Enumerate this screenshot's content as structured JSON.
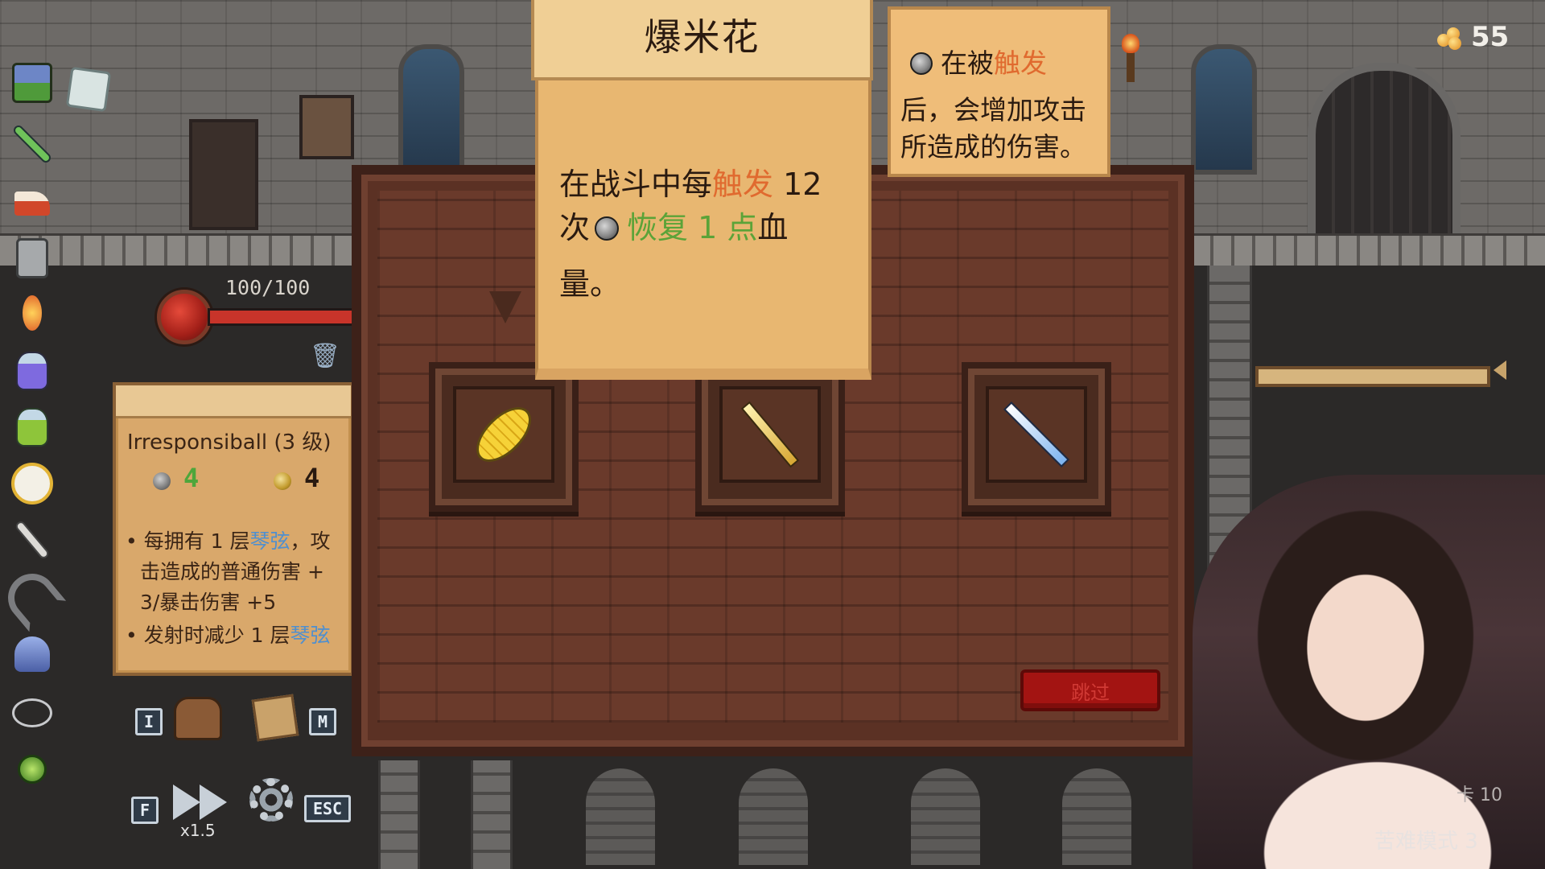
{
  "tooltip": {
    "title": "爆米花",
    "line1_pre": "在战斗中每",
    "line1_trigger": "触发",
    "line1_post": " 12",
    "line2_pre": "次",
    "line2_heal": "恢复 1 点",
    "line2_post": "血",
    "line3": "量。"
  },
  "keyword_card": {
    "line1_pre": "在被",
    "line1_trigger": "触发",
    "line2": "后，会增加攻击",
    "line3": "所造成的伤害。"
  },
  "gold": {
    "count": "55",
    "icon": "gold-nuggets-icon"
  },
  "hp": {
    "text": "100/100",
    "fraction": 1.0
  },
  "item_card": {
    "name": "Irresponsiball (3 级)",
    "stat_gray": "4",
    "stat_gold": "4",
    "bullet1_pre": "每拥有 1 层",
    "bullet1_hl": "琴弦",
    "bullet1_post": "，攻",
    "bullet1_line2": "击造成的普通伤害 +",
    "bullet1_line3": "3/暴击伤害 +5",
    "bullet2_pre": "发射时减少 1 层",
    "bullet2_hl": "琴弦"
  },
  "controls": {
    "i_key": "I",
    "m_key": "M",
    "f_key": "F",
    "speed": "x1.5",
    "esc_key": "ESC"
  },
  "reward": {
    "slots": [
      {
        "icon": "corn-icon"
      },
      {
        "icon": "golden-dagger-icon"
      },
      {
        "icon": "ice-sword-icon"
      }
    ],
    "skip_label": "跳过"
  },
  "inventory": [
    "treasure-chest-icon",
    "cube-icon",
    "green-sword-icon",
    "pie-icon",
    "beer-mug-icon",
    "torch-flower-icon",
    "potion-icon",
    "potion-icon",
    "clock-icon",
    "dagger-icon",
    "magnet-icon",
    "wizard-hat-icon",
    "cloud-icon",
    "green-orb-icon"
  ],
  "webcam": {
    "mode_text": "苦难模式 3",
    "corner_text": "卡 10"
  },
  "colors": {
    "trigger": "#e06a2f",
    "heal": "#5ba338",
    "skip_button": "#a31412",
    "keyword_blue": "#4f8fcf"
  }
}
